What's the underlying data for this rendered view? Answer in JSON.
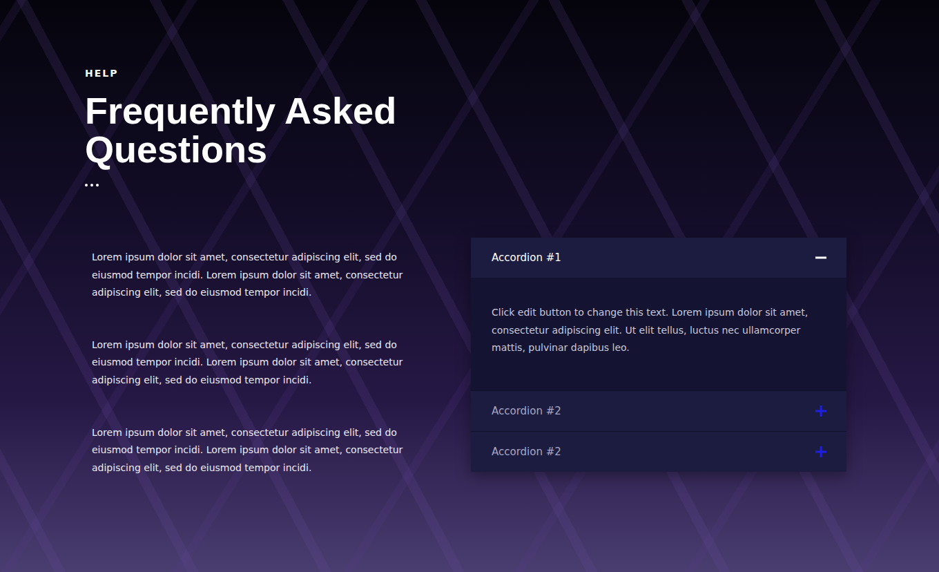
{
  "section": {
    "eyebrow": "HELP",
    "title": "Frequently Asked Questions"
  },
  "paragraphs": [
    "Lorem ipsum dolor sit amet, consectetur adipiscing elit, sed do eiusmod tempor incidi. Lorem ipsum dolor sit amet, consectetur adipiscing elit, sed do eiusmod tempor incidi.",
    "Lorem ipsum dolor sit amet, consectetur adipiscing elit, sed do eiusmod tempor incidi. Lorem ipsum dolor sit amet, consectetur adipiscing elit, sed do eiusmod tempor incidi.",
    "Lorem ipsum dolor sit amet, consectetur adipiscing elit, sed do eiusmod tempor incidi. Lorem ipsum dolor sit amet, consectetur adipiscing elit, sed do eiusmod tempor incidi."
  ],
  "accordion": [
    {
      "title": "Accordion #1",
      "expanded": true,
      "body": "Click edit button to change this text. Lorem ipsum dolor sit amet, consectetur adipiscing elit. Ut elit tellus, luctus nec ullamcorper mattis, pulvinar dapibus leo."
    },
    {
      "title": "Accordion #2",
      "expanded": false,
      "body": ""
    },
    {
      "title": "Accordion #2",
      "expanded": false,
      "body": ""
    }
  ]
}
